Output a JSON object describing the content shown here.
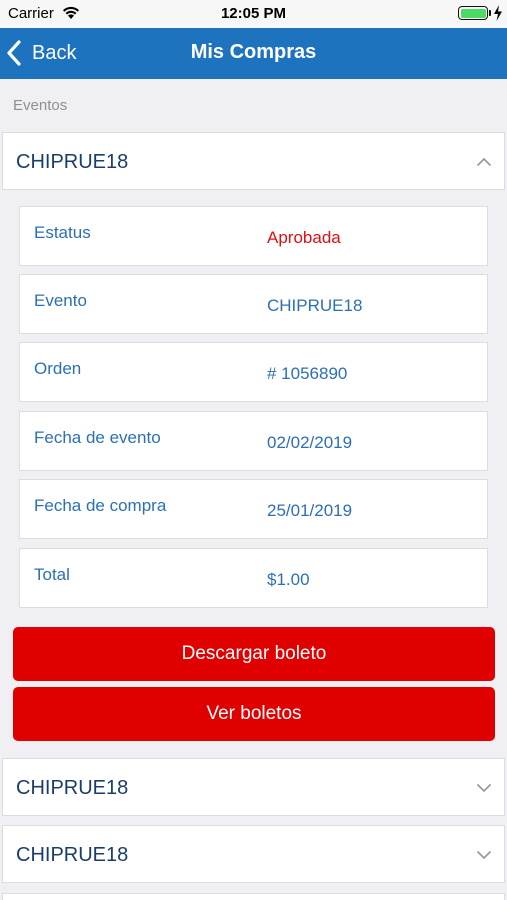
{
  "status_bar": {
    "carrier": "Carrier",
    "time": "12:05 PM",
    "battery_color": "#4cd964"
  },
  "nav": {
    "back_label": "Back",
    "title": "Mis Compras",
    "bar_color": "#1e73be"
  },
  "section_label": "Eventos",
  "purchases": [
    {
      "name": "CHIPRUE18",
      "expanded": true,
      "details": [
        {
          "label": "Estatus",
          "value": "Aprobada",
          "value_color": "#e01010"
        },
        {
          "label": "Evento",
          "value": "CHIPRUE18"
        },
        {
          "label": "Orden",
          "value": "# 1056890"
        },
        {
          "label": "Fecha de evento",
          "value": "02/02/2019"
        },
        {
          "label": "Fecha de compra",
          "value": "25/01/2019"
        },
        {
          "label": "Total",
          "value": "$1.00"
        }
      ],
      "actions": [
        {
          "label": "Descargar boleto"
        },
        {
          "label": "Ver boletos"
        }
      ]
    },
    {
      "name": "CHIPRUE18",
      "expanded": false
    },
    {
      "name": "CHIPRUE18",
      "expanded": false
    }
  ],
  "action_color": "#e00000"
}
